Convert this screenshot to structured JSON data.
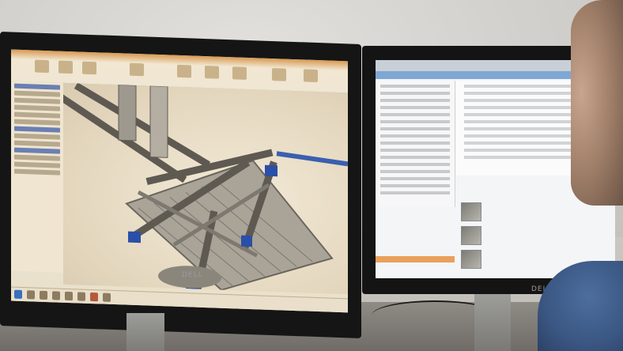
{
  "monitors": {
    "left_brand": "DELL",
    "right_brand": "DELL"
  },
  "icons": {
    "person": "person-silhouette",
    "cad_model": "robotic-frame-3d-model"
  },
  "colors": {
    "cad_ribbon": "#d89a52",
    "viewport_bg": "#eae1cc",
    "right_accent": "#7fa7d4",
    "right_orange": "#e9a05c",
    "joint_blue": "#2a4fa8"
  }
}
